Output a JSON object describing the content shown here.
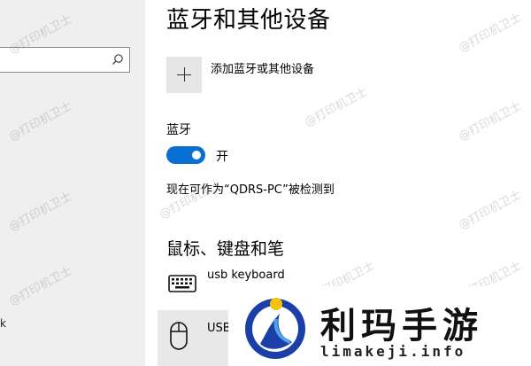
{
  "watermark": "@打印机卫士",
  "sidebar": {
    "search": {
      "placeholder": "",
      "icon": "search-icon"
    },
    "bottom_item_fragment": "k"
  },
  "main": {
    "page_title": "蓝牙和其他设备",
    "add_device_label": "添加蓝牙或其他设备",
    "bluetooth": {
      "label": "蓝牙",
      "toggle_state": "开",
      "is_on": true,
      "discoverable_text": "现在可作为“QDRS-PC”被检测到"
    },
    "section_title": "鼠标、键盘和笔",
    "devices": [
      {
        "name": "usb keyboard",
        "icon": "keyboard-icon"
      },
      {
        "name": "USB",
        "icon": "mouse-icon"
      }
    ]
  },
  "overlay": {
    "brand_name": "利玛手游",
    "brand_url": "limakeji.info"
  },
  "colors": {
    "accent": "#0a6fd2",
    "sidebar_bg": "#efefef",
    "selected_row": "#e8e8e8"
  }
}
